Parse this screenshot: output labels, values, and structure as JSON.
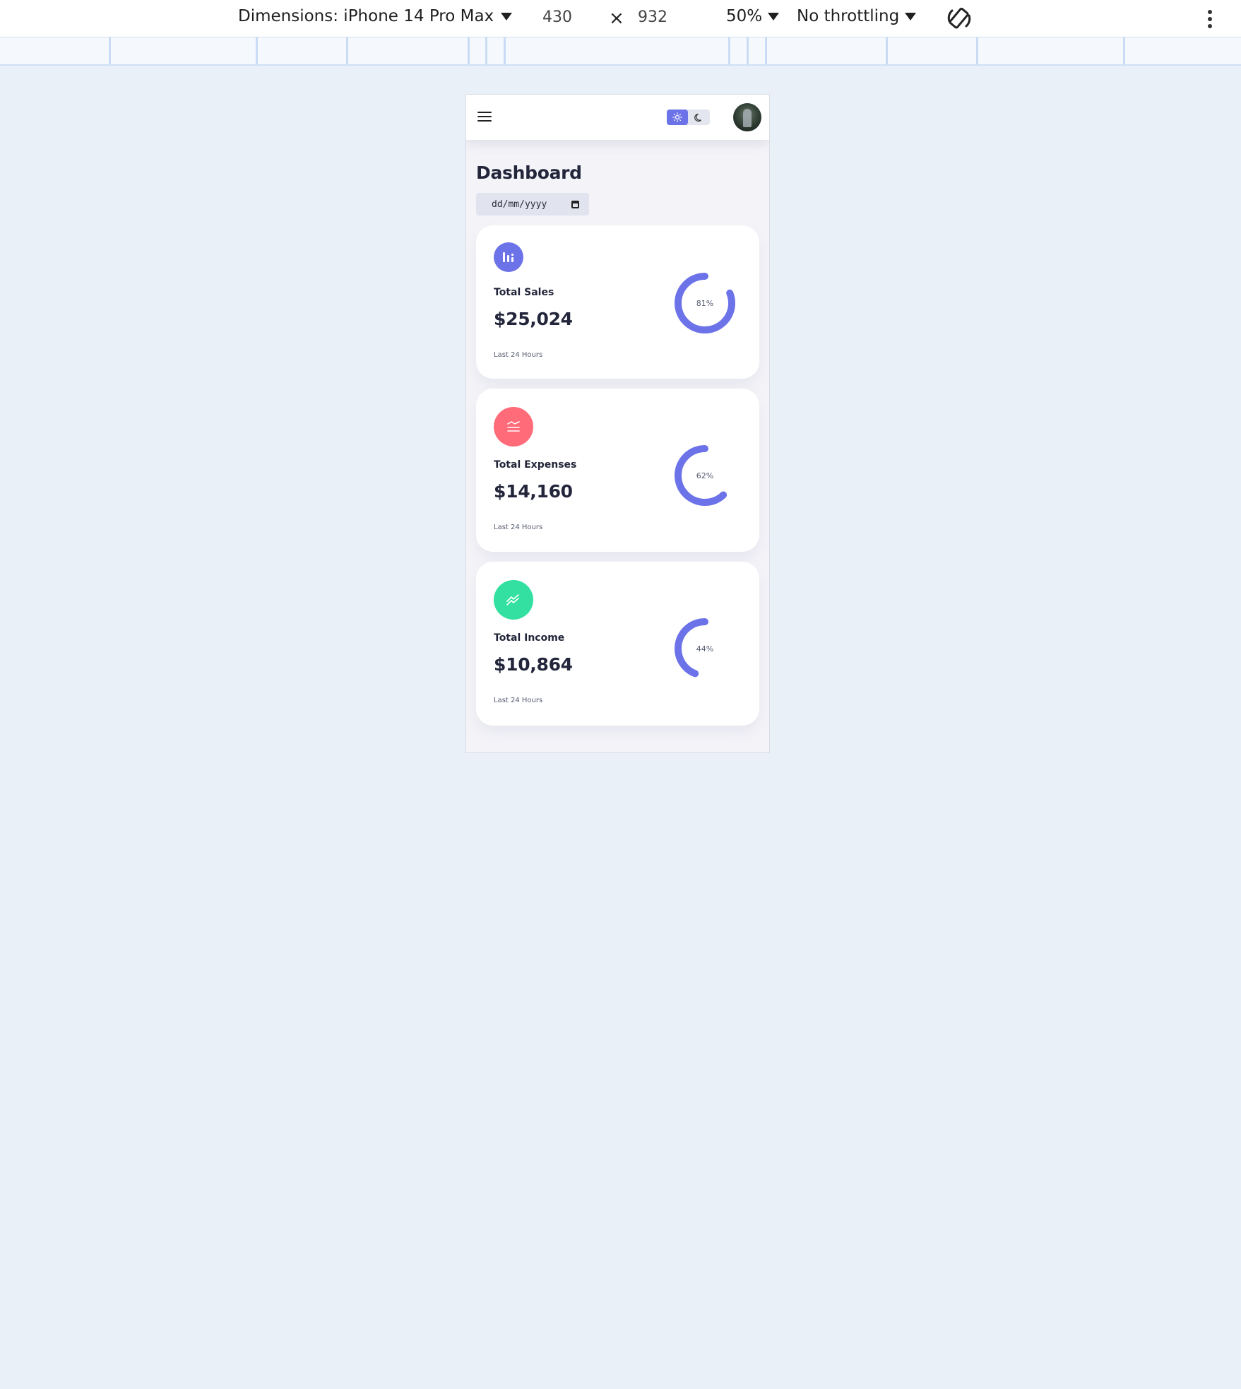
{
  "devtools": {
    "dimensions_label": "Dimensions: iPhone 14 Pro Max",
    "width": "430",
    "times": "×",
    "height": "932",
    "zoom": "50%",
    "throttling": "No throttling"
  },
  "app": {
    "title": "Dashboard",
    "date_placeholder": "dd/mm/yyyy",
    "theme": {
      "light_active": true
    },
    "colors": {
      "accent": "#6c72e8",
      "danger": "#ff6b78",
      "success": "#33e0a1",
      "background": "#f4f4f8"
    },
    "cards": [
      {
        "icon": "bar-chart-icon",
        "icon_color": "#6c72e8",
        "label": "Total Sales",
        "amount": "$25,024",
        "period": "Last 24 Hours",
        "percent_label": "81%",
        "percent": 81
      },
      {
        "icon": "lines-icon",
        "icon_color": "#ff6b78",
        "label": "Total Expenses",
        "amount": "$14,160",
        "period": "Last 24 Hours",
        "percent_label": "62%",
        "percent": 62
      },
      {
        "icon": "trending-up-icon",
        "icon_color": "#33e0a1",
        "label": "Total Income",
        "amount": "$10,864",
        "period": "Last 24 Hours",
        "percent_label": "44%",
        "percent": 44
      }
    ]
  }
}
